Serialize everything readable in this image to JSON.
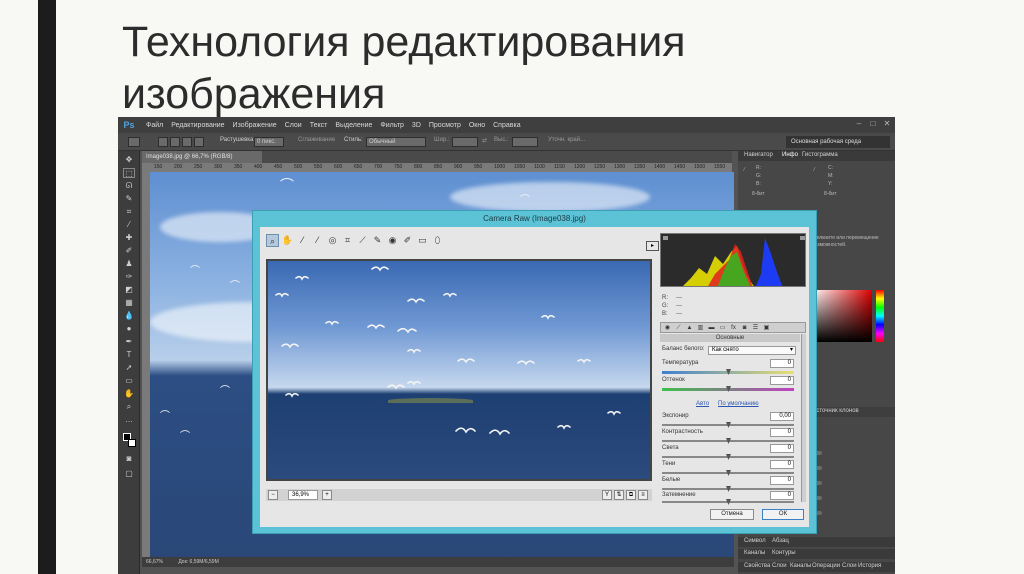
{
  "slide": {
    "title_line1": "Технология редактирования",
    "title_line2": "изображения"
  },
  "photoshop": {
    "logo": "Ps",
    "menu": [
      "Файл",
      "Редактирование",
      "Изображение",
      "Слои",
      "Текст",
      "Выделение",
      "Фильтр",
      "3D",
      "Просмотр",
      "Окно",
      "Справка"
    ],
    "options": {
      "feather_label": "Растушевка:",
      "feather_value": "0 пикс.",
      "smoothing_label": "Сглаживание",
      "style_label": "Стиль:",
      "style_value": "Обычный",
      "width_label": "Шир.:",
      "height_label": "Выс.:",
      "refine_label": "Уточн. край..."
    },
    "workspace": "Основная рабочая среда",
    "document_tab": "Image038.jpg @ 66,7% (RGB/8)",
    "ruler_ticks": [
      "150",
      "200",
      "250",
      "300",
      "350",
      "400",
      "450",
      "500",
      "550",
      "600",
      "650",
      "700",
      "750",
      "800",
      "850",
      "900",
      "950",
      "1000",
      "1050",
      "1100",
      "1150",
      "1200",
      "1250",
      "1300",
      "1350",
      "1400",
      "1450",
      "1500",
      "1550"
    ],
    "status_zoom": "66,67%",
    "status_doc": "Док: 6,59М/6,59М",
    "panels": {
      "top_tabs": [
        "Навигатор",
        "Инфо",
        "Гистограмма"
      ],
      "info_rows": [
        "R:",
        "G:",
        "B:",
        "8-бит"
      ],
      "hint_text": [
        "Щелкните или перемещение",
        "возможностей."
      ],
      "mid_tab": "Источник клонов",
      "bottom_tabs_1": [
        "Символ",
        "Абзац"
      ],
      "bottom_tabs_2": [
        "Каналы",
        "Контуры"
      ],
      "bottom_tabs_3": [
        "Свойства",
        "Слои",
        "Каналы",
        "Операции",
        "Слои",
        "История"
      ]
    }
  },
  "camera_raw": {
    "title": "Camera Raw (Image038.jpg)",
    "zoom": "36,9%",
    "rgb_labels": [
      "R:",
      "G:",
      "B:"
    ],
    "rgb_values": [
      "---",
      "---",
      "---"
    ],
    "section": "Основные",
    "white_balance_label": "Баланс белого:",
    "white_balance_value": "Как снято",
    "sliders": [
      {
        "label": "Температура",
        "value": "0"
      },
      {
        "label": "Оттенок",
        "value": "0"
      },
      {
        "label": "Экспонир",
        "value": "0,00"
      },
      {
        "label": "Контрастность",
        "value": "0"
      },
      {
        "label": "Света",
        "value": "0"
      },
      {
        "label": "Тени",
        "value": "0"
      },
      {
        "label": "Белые",
        "value": "0"
      },
      {
        "label": "Затемнение",
        "value": "0"
      }
    ],
    "auto_link": "Авто",
    "default_link": "По умолчанию",
    "cancel": "Отмена",
    "ok": "ОК",
    "colors": {
      "frame": "#5bc3d5",
      "histogram_bg": "#2b2b2b"
    }
  }
}
